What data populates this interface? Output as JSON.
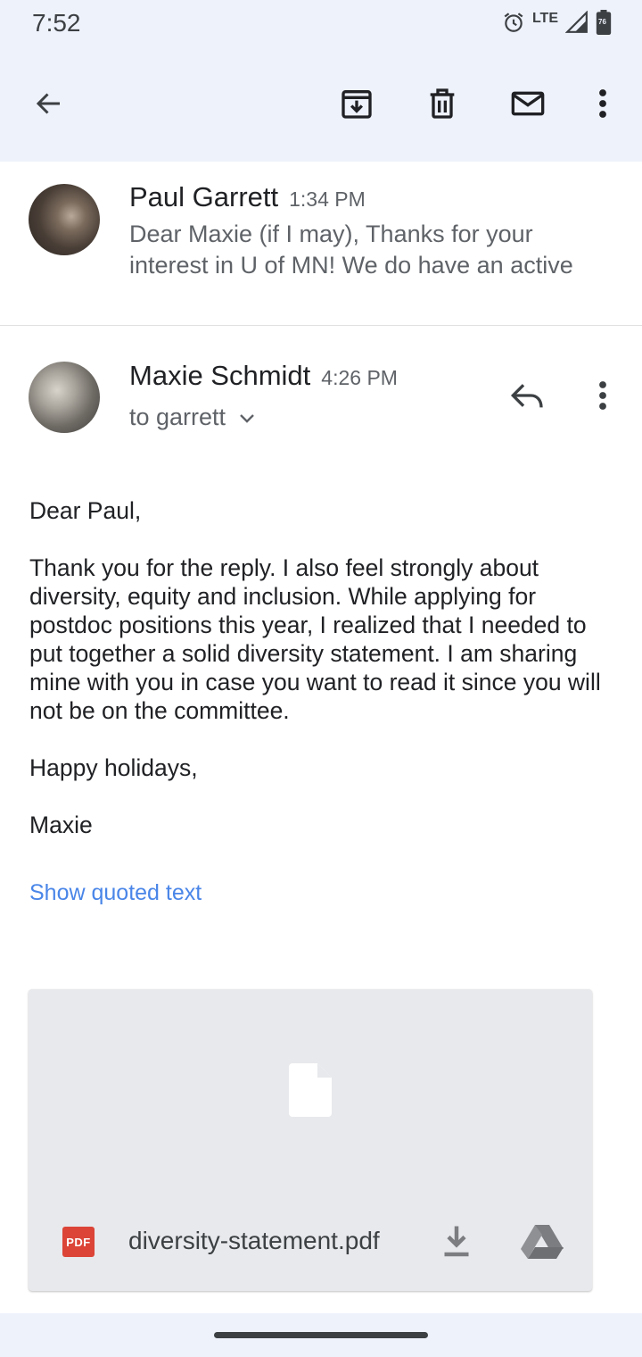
{
  "status": {
    "time": "7:52",
    "network": "LTE",
    "battery_level": "76",
    "icons": [
      "alarm-icon",
      "signal-icon",
      "battery-icon"
    ]
  },
  "toolbar": {
    "icons": [
      "back-arrow-icon",
      "archive-icon",
      "delete-icon",
      "mail-icon",
      "more-vert-icon"
    ]
  },
  "messages": [
    {
      "sender": "Paul Garrett",
      "time": "1:34 PM",
      "snippet": "Dear Maxie (if I may), Thanks for your interest in U of MN! We do have an active"
    },
    {
      "sender": "Maxie Schmidt",
      "time": "4:26 PM",
      "recipient": "to garrett",
      "body": [
        "Dear Paul,",
        "Thank you for the reply. I also feel strongly about diversity, equity and inclusion. While applying for postdoc positions this year, I realized that I needed to put together a solid diversity statement. I am sharing mine with you in case you want to read it since you will not be on the committee.",
        "Happy holidays,",
        "Maxie"
      ],
      "show_quoted": "Show quoted text"
    }
  ],
  "attachment": {
    "type_badge": "PDF",
    "filename": "diversity-statement.pdf"
  },
  "colors": {
    "bar_bg": "#eef2fb",
    "link": "#4a86e8",
    "pdf_red": "#db4437"
  }
}
